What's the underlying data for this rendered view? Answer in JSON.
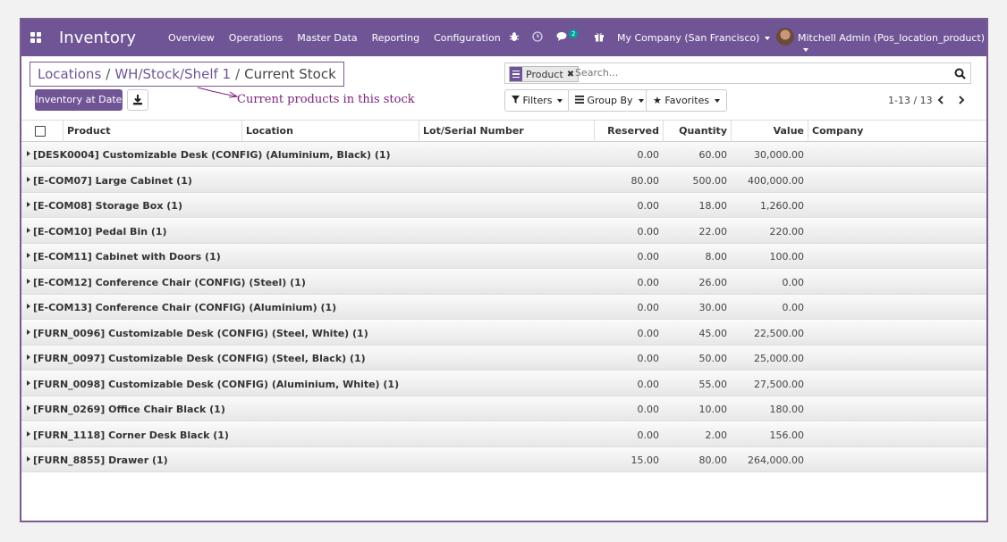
{
  "navbar": {
    "app_title": "Inventory",
    "menu": [
      "Overview",
      "Operations",
      "Master Data",
      "Reporting",
      "Configuration"
    ],
    "messages_count": "2",
    "company": "My Company (San Francisco)",
    "user": "Mitchell Admin (Pos_location_product)"
  },
  "breadcrumb": {
    "items": [
      "Locations",
      "WH/Stock/Shelf 1"
    ],
    "current": "Current Stock"
  },
  "buttons": {
    "inventory_at_date": "Inventory at Date"
  },
  "annotation": "Current products in this stock",
  "search": {
    "facet": "Product",
    "placeholder": "Search..."
  },
  "filters": {
    "filters": "Filters",
    "group_by": "Group By",
    "favorites": "Favorites"
  },
  "pager": "1-13 / 13",
  "table": {
    "columns": [
      "Product",
      "Location",
      "Lot/Serial Number",
      "Reserved",
      "Quantity",
      "Value",
      "Company"
    ],
    "rows": [
      {
        "name": "[DESK0004] Customizable Desk (CONFIG) (Aluminium, Black) (1)",
        "reserved": "0.00",
        "quantity": "60.00",
        "value": "30,000.00"
      },
      {
        "name": "[E-COM07] Large Cabinet (1)",
        "reserved": "80.00",
        "quantity": "500.00",
        "value": "400,000.00"
      },
      {
        "name": "[E-COM08] Storage Box (1)",
        "reserved": "0.00",
        "quantity": "18.00",
        "value": "1,260.00"
      },
      {
        "name": "[E-COM10] Pedal Bin (1)",
        "reserved": "0.00",
        "quantity": "22.00",
        "value": "220.00"
      },
      {
        "name": "[E-COM11] Cabinet with Doors (1)",
        "reserved": "0.00",
        "quantity": "8.00",
        "value": "100.00"
      },
      {
        "name": "[E-COM12] Conference Chair (CONFIG) (Steel) (1)",
        "reserved": "0.00",
        "quantity": "26.00",
        "value": "0.00"
      },
      {
        "name": "[E-COM13] Conference Chair (CONFIG) (Aluminium) (1)",
        "reserved": "0.00",
        "quantity": "30.00",
        "value": "0.00"
      },
      {
        "name": "[FURN_0096] Customizable Desk (CONFIG) (Steel, White) (1)",
        "reserved": "0.00",
        "quantity": "45.00",
        "value": "22,500.00"
      },
      {
        "name": "[FURN_0097] Customizable Desk (CONFIG) (Steel, Black) (1)",
        "reserved": "0.00",
        "quantity": "50.00",
        "value": "25,000.00"
      },
      {
        "name": "[FURN_0098] Customizable Desk (CONFIG) (Aluminium, White) (1)",
        "reserved": "0.00",
        "quantity": "55.00",
        "value": "27,500.00"
      },
      {
        "name": "[FURN_0269] Office Chair Black (1)",
        "reserved": "0.00",
        "quantity": "10.00",
        "value": "180.00"
      },
      {
        "name": "[FURN_1118] Corner Desk Black (1)",
        "reserved": "0.00",
        "quantity": "2.00",
        "value": "156.00"
      },
      {
        "name": "[FURN_8855] Drawer (1)",
        "reserved": "15.00",
        "quantity": "80.00",
        "value": "264,000.00"
      }
    ]
  }
}
